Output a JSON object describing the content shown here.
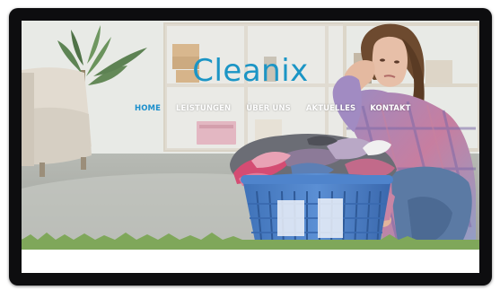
{
  "site": {
    "logo": "Cleanix"
  },
  "nav": {
    "items": [
      {
        "label": "HOME",
        "active": true
      },
      {
        "label": "LEISTUNGEN",
        "active": false
      },
      {
        "label": "ÜBER UNS",
        "active": false
      },
      {
        "label": "AKTUELLES",
        "active": false
      },
      {
        "label": "KONTAKT",
        "active": false
      }
    ]
  },
  "colors": {
    "brand": "#1b95c5",
    "nav_active": "#1b8fcc",
    "nav_text": "#ffffff",
    "monitor_bezel": "#0d0d0f"
  }
}
